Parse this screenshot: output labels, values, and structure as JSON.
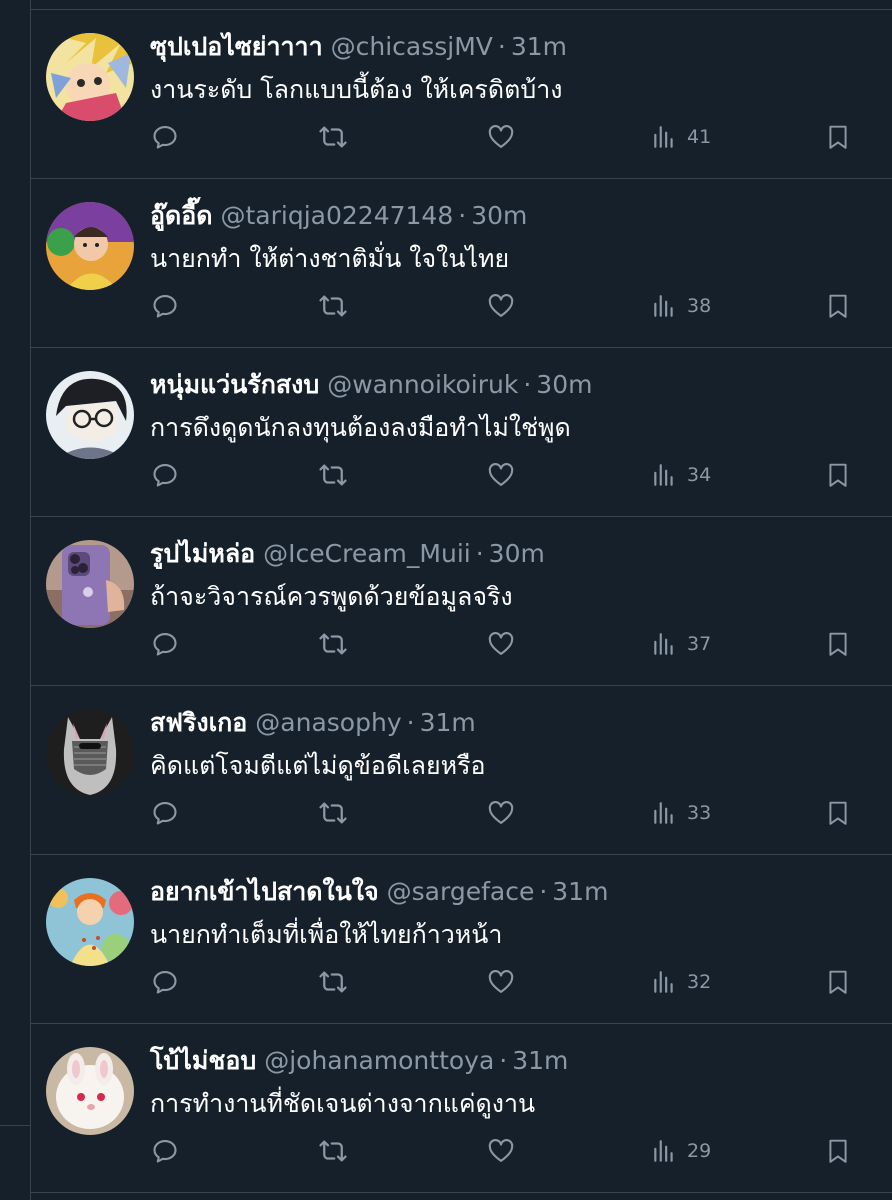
{
  "colors": {
    "background": "#15202b",
    "border": "#38444d",
    "secondary_text": "#8b98a5",
    "primary_text": "#ffffff"
  },
  "separator": "·",
  "icons": [
    "reply-icon",
    "retweet-icon",
    "like-icon",
    "views-icon",
    "bookmark-icon"
  ],
  "tweets": [
    {
      "name": "ซุปเปอไซย่าาาา",
      "handle": "@chicassjMV",
      "time": "31m",
      "text": "งานระดับ โลกแบบนี้ต้อง ให้เครดิตบ้าง",
      "views": "41",
      "avatar": "anime-character-avatar"
    },
    {
      "name": "อู๊ดอี๊ด",
      "handle": "@tariqja02247148",
      "time": "30m",
      "text": "นายกทำ ให้ต่างชาติมั่น ใจในไทย",
      "views": "38",
      "avatar": "baby-photo-avatar"
    },
    {
      "name": "หนุ่มแว่นรักสงบ",
      "handle": "@wannoikoiruk",
      "time": "30m",
      "text": "การดึงดูดนักลงทุนต้องลงมือทำไม่ใช่พูด",
      "views": "34",
      "avatar": "glasses-anime-avatar"
    },
    {
      "name": "รูปไม่หล่อ",
      "handle": "@IceCream_Muii",
      "time": "30m",
      "text": "ถ้าจะวิจารณ์ควรพูดด้วยข้อมูลจริง",
      "views": "37",
      "avatar": "purple-phone-avatar"
    },
    {
      "name": "สฟริงเกอ",
      "handle": "@anasophy",
      "time": "31m",
      "text": "คิดแต่โจมตีแต่ไม่ดูข้อดีเลยหรือ",
      "views": "33",
      "avatar": "cat-hood-avatar"
    },
    {
      "name": "อยากเข้าไปสาดในใจ",
      "handle": "@sargeface",
      "time": "31m",
      "text": "นายกทำเต็มที่เพื่อให้ไทยก้าวหน้า",
      "views": "32",
      "avatar": "cartoon-boy-avatar"
    },
    {
      "name": "โบ้ไม่ชอบ",
      "handle": "@johanamonttoya",
      "time": "31m",
      "text": "การทำงานที่ชัดเจนต่างจากแค่ดูงาน",
      "views": "29",
      "avatar": "white-bunny-avatar"
    }
  ]
}
